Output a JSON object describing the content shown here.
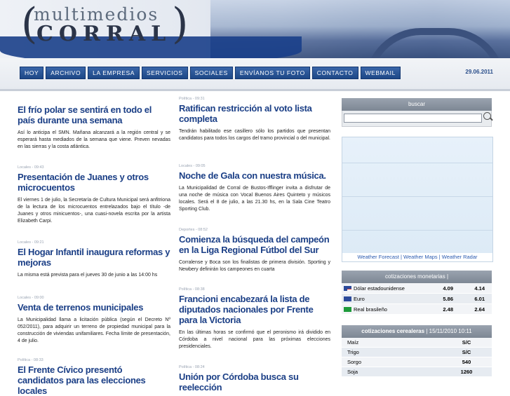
{
  "header": {
    "logo_top": "multimedios",
    "logo_bottom": "CORRAL",
    "paren_left": "(",
    "paren_right": ")"
  },
  "nav": {
    "items": [
      "HOY",
      "ARCHIVO",
      "LA EMPRESA",
      "SERVICIOS",
      "SOCIALES",
      "ENVÍANOS TU FOTO",
      "CONTACTO",
      "WEBMAIL"
    ],
    "date": "29.06.2011"
  },
  "col1": [
    {
      "category": "",
      "title": "El frío polar se sentirá en todo el país durante una semana",
      "text": "Así lo anticipa el SMN. Mañana alcanzará a la región central y se esperará hasta mediados de la semana que viene. Preven nevadas en las sierras y la costa atlántica."
    },
    {
      "category": "Locales - 09:43",
      "title": "Presentación de Juanes y otros microcuentos",
      "text": "El viernes 1 de julio, la Secretaría de Cultura Municipal será anfitriona de la lectura de los microcuentos entrelazados bajo el título -de Juanes y otros minicuentos-, una cuasi-novela escrita por la artista Elizabeth Carpi."
    },
    {
      "category": "Locales - 09:21",
      "title": "El Hogar Infantil inaugura reformas y mejoras",
      "text": "La misma está prevista para el jueves 30 de junio a las 14:00 hs"
    },
    {
      "category": "Locales - 09:00",
      "title": "Venta de terrenos municipales",
      "text": "La Municipalidad llama a licitación pública (según el Decreto Nº 052/2011), para adquirir un terreno de propiedad municipal para la construcción de viviendas unifamiliares. Fecha límite de presentación, 4 de julio."
    },
    {
      "category": "Política - 08:33",
      "title": "El Frente Cívico presentó candidatos para las elecciones locales",
      "text": ""
    }
  ],
  "col2": [
    {
      "category": "Política - 09:31",
      "title": "Ratifican restricción al voto lista completa",
      "text": "Tendrán habilitado ese casillero sólo los partidos que presentan candidatos para todos los cargos del tramo provincial o del municipal."
    },
    {
      "category": "Locales - 09:05",
      "title": "Noche de Gala con nuestra música.",
      "text": "La Municipalidad de Corral de Bustos-Ifflinger invita a disfrutar de una noche de música con Vocal Buenos Aires Quinteto y músicos locales. Será el 8 de julio, a las 21.30 hs, en la Sala Cine Teatro Sporting Club."
    },
    {
      "category": "Deportes - 08:52",
      "title": "Comienza la búsqueda del campeón en la Liga Regional Fútbol del Sur",
      "text": "Corralense y Boca son los finalistas de primera división. Sporting y Newbery definirán los campeones en cuarta"
    },
    {
      "category": "Política - 08:38",
      "title": "Francioni encabezará la lista de diputados nacionales por Frente para la Victoria",
      "text": "En las últimas horas se confirmó que el peronismo irá dividido en Córdoba a nivel nacional para las próximas elecciones presidenciales."
    },
    {
      "category": "Política - 08:24",
      "title": "Unión por Córdoba busca su reelección",
      "text": ""
    }
  ],
  "sidebar": {
    "search_label": "buscar",
    "search_value": "",
    "weather_links": "Weather Forecast | Weather Maps | Weather Radar",
    "currency_title": "cotizaciones monetarias |",
    "currency": [
      {
        "flag": "us",
        "name": "Dólar estadounidense",
        "buy": "4.09",
        "sell": "4.14"
      },
      {
        "flag": "eu",
        "name": "Euro",
        "buy": "5.86",
        "sell": "6.01"
      },
      {
        "flag": "br",
        "name": "Real brasileño",
        "buy": "2.48",
        "sell": "2.64"
      }
    ],
    "grain_title": "cotizaciones cerealeras",
    "grain_date": "| 15/11/2010 10:11",
    "grains": [
      {
        "name": "Maíz",
        "value": "S/C"
      },
      {
        "name": "Trigo",
        "value": "S/C"
      },
      {
        "name": "Sorgo",
        "value": "540"
      },
      {
        "name": "Soja",
        "value": "1260"
      }
    ]
  },
  "colors": {
    "accent": "#1b3f86",
    "nav_button": "#2a579a"
  }
}
